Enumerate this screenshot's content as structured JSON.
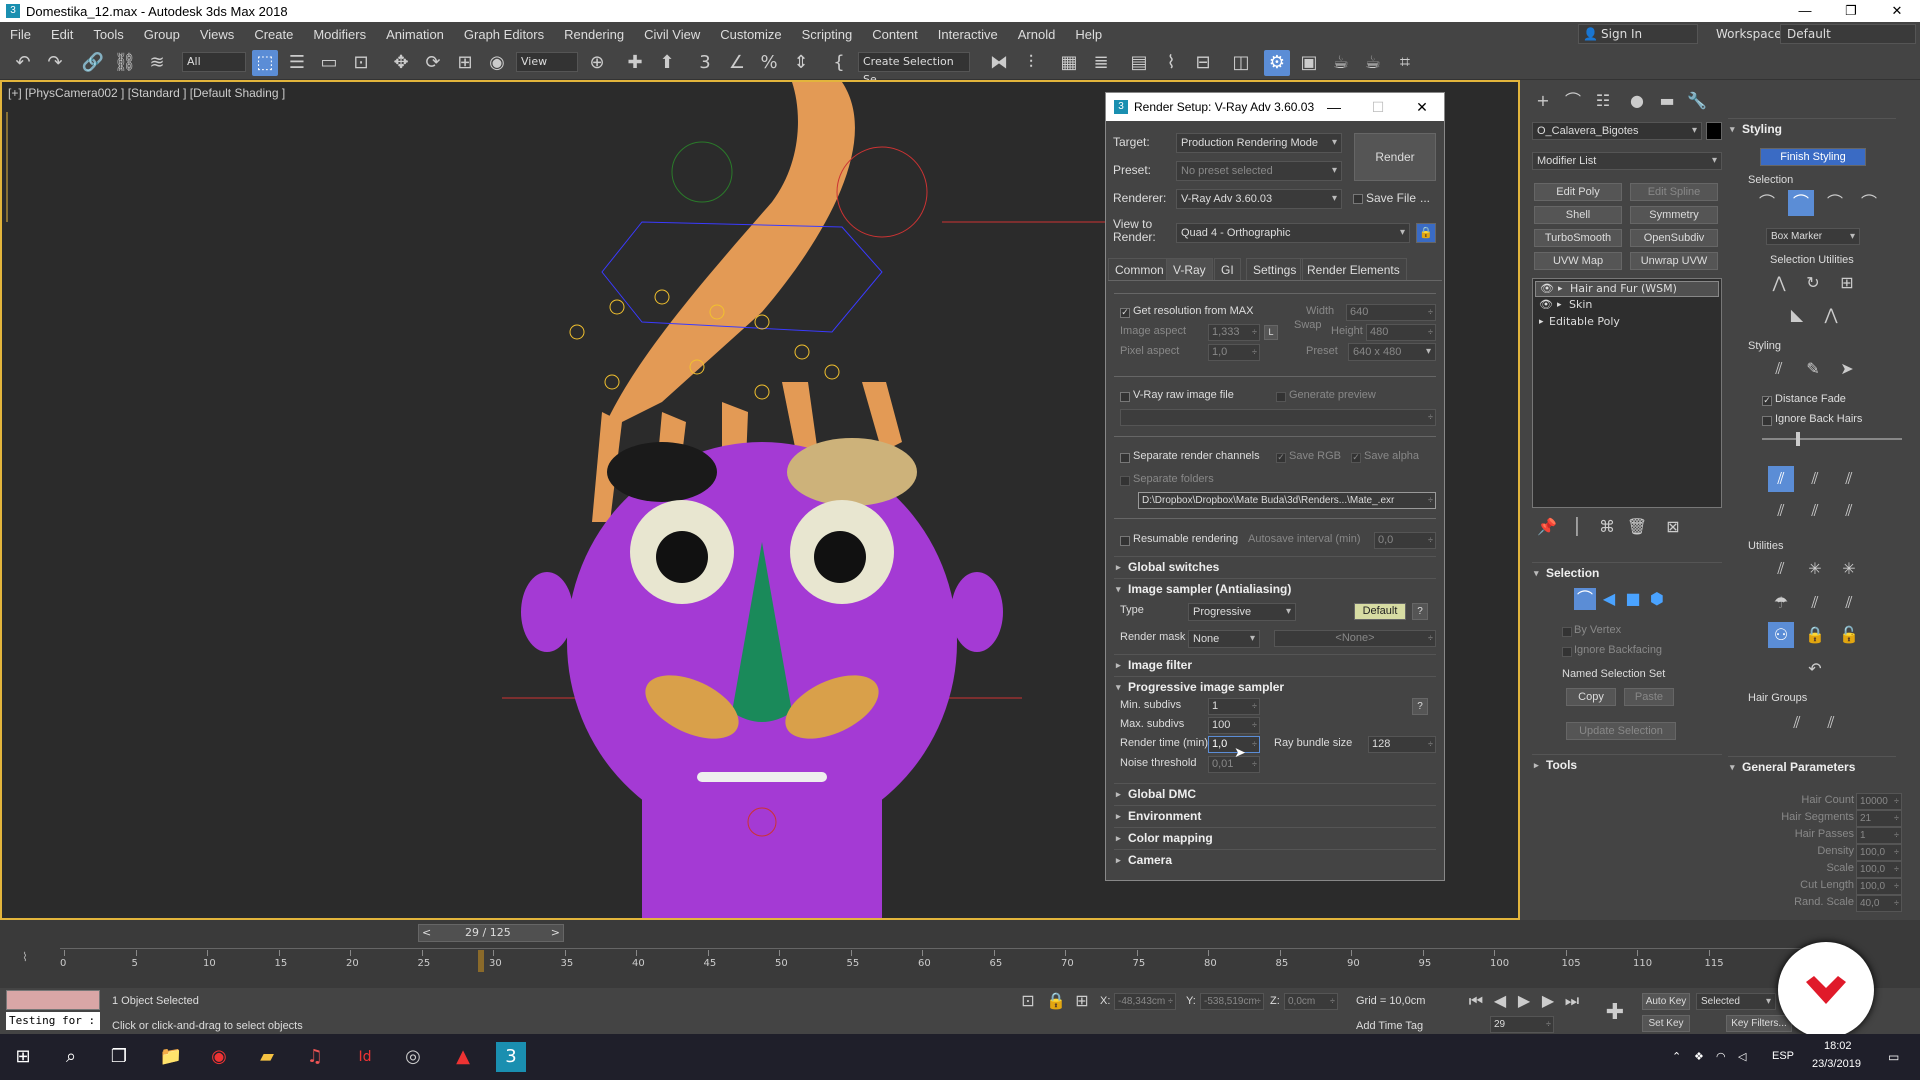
{
  "window": {
    "title": "Domestika_12.max - Autodesk 3ds Max 2018",
    "minimize": "—",
    "maximize": "❐",
    "close": "✕"
  },
  "menu": [
    "File",
    "Edit",
    "Tools",
    "Group",
    "Views",
    "Create",
    "Modifiers",
    "Animation",
    "Graph Editors",
    "Rendering",
    "Civil View",
    "Customize",
    "Scripting",
    "Content",
    "Interactive",
    "Arnold",
    "Help"
  ],
  "account": {
    "sign_in": "Sign In",
    "workspaces_label": "Workspaces:",
    "workspace": "Default"
  },
  "toolbar": {
    "filter": "All",
    "view": "View",
    "selection_set": "Create Selection Se"
  },
  "viewport": {
    "label": "[+] [PhysCamera002 ] [Standard ] [Default Shading ]"
  },
  "render_setup": {
    "title": "Render Setup: V-Ray Adv 3.60.03",
    "target_label": "Target:",
    "target": "Production Rendering Mode",
    "preset_label": "Preset:",
    "preset": "No preset selected",
    "renderer_label": "Renderer:",
    "renderer": "V-Ray Adv 3.60.03",
    "save_file": "Save File",
    "more": "...",
    "view_label": "View to Render:",
    "view": "Quad 4 - Orthographic",
    "render_button": "Render",
    "tabs": [
      "Common",
      "V-Ray",
      "GI",
      "Settings",
      "Render Elements"
    ],
    "get_res": "Get resolution from MAX",
    "width_label": "Width",
    "width": "640",
    "image_aspect_label": "Image aspect",
    "image_aspect": "1,333",
    "lock": "L",
    "swap": "Swap",
    "height_label": "Height",
    "height": "480",
    "pixel_aspect_label": "Pixel aspect",
    "pixel_aspect": "1,0",
    "preset_res_label": "Preset",
    "preset_res": "640 x 480",
    "raw_image": "V-Ray raw image file",
    "gen_preview": "Generate preview",
    "sep_channels": "Separate render channels",
    "save_rgb": "Save RGB",
    "save_alpha": "Save alpha",
    "sep_folders": "Separate folders",
    "path": "D:\\Dropbox\\Dropbox\\Mate Buda\\3d\\Renders...\\Mate_.exr",
    "resumable": "Resumable rendering",
    "autosave_label": "Autosave interval (min)",
    "autosave": "0,0",
    "global_switches": "Global switches",
    "image_sampler": "Image sampler (Antialiasing)",
    "type_label": "Type",
    "type": "Progressive",
    "default_btn": "Default",
    "help": "?",
    "render_mask_label": "Render mask",
    "render_mask": "None",
    "mask_none": "<None>",
    "image_filter": "Image filter",
    "prog_sampler": "Progressive image sampler",
    "min_subdivs_label": "Min. subdivs",
    "min_subdivs": "1",
    "max_subdivs_label": "Max. subdivs",
    "max_subdivs": "100",
    "render_time_label": "Render time (min)",
    "render_time": "1,0",
    "ray_bundle_label": "Ray bundle size",
    "ray_bundle": "128",
    "noise_label": "Noise threshold",
    "noise": "0,01",
    "global_dmc": "Global DMC",
    "environment": "Environment",
    "color_mapping": "Color mapping",
    "camera": "Camera"
  },
  "command_panel": {
    "object_name": "O_Calavera_Bigotes",
    "modifier_list": "Modifier List",
    "mod_buttons": [
      "Edit Poly",
      "Edit Spline",
      "Shell",
      "Symmetry",
      "TurboSmooth",
      "OpenSubdiv",
      "UVW Map",
      "Unwrap UVW"
    ],
    "stack": [
      "Hair and Fur (WSM)",
      "Skin",
      "Editable Poly"
    ],
    "selection": "Selection",
    "by_vertex": "By Vertex",
    "ignore_backfacing": "Ignore Backfacing",
    "named_sel": "Named Selection Set",
    "copy": "Copy",
    "paste": "Paste",
    "update_sel": "Update Selection",
    "tools": "Tools"
  },
  "hair_panel": {
    "styling": "Styling",
    "finish_styling": "Finish Styling",
    "selection": "Selection",
    "box_marker": "Box Marker",
    "sel_utils": "Selection Utilities",
    "styling2": "Styling",
    "distance_fade": "Distance Fade",
    "ignore_back": "Ignore Back Hairs",
    "utilities": "Utilities",
    "hair_groups": "Hair Groups",
    "general_params": "General Parameters",
    "params": [
      {
        "label": "Hair Count",
        "value": "10000"
      },
      {
        "label": "Hair Segments",
        "value": "21"
      },
      {
        "label": "Hair Passes",
        "value": "1"
      },
      {
        "label": "Density",
        "value": "100,0"
      },
      {
        "label": "Scale",
        "value": "100,0"
      },
      {
        "label": "Cut Length",
        "value": "100,0"
      },
      {
        "label": "Rand. Scale",
        "value": "40,0"
      }
    ]
  },
  "timeline": {
    "frame": "29 / 125",
    "prev": "<",
    "next": ">",
    "ticks": [
      "0",
      "5",
      "10",
      "15",
      "20",
      "25",
      "30",
      "35",
      "40",
      "45",
      "50",
      "55",
      "60",
      "65",
      "70",
      "75",
      "80",
      "85",
      "90",
      "95",
      "100",
      "105",
      "110",
      "115"
    ]
  },
  "status": {
    "maxscript": "Testing for :",
    "selected": "1 Object Selected",
    "prompt": "Click or click-and-drag to select objects",
    "x_label": "X:",
    "x": "-48,343cm",
    "y_label": "Y:",
    "y": "-538,519cm",
    "z_label": "Z:",
    "z": "0,0cm",
    "grid": "Grid = 10,0cm",
    "add_time_tag": "Add Time Tag",
    "auto_key": "Auto Key",
    "selected_mode": "Selected",
    "set_key": "Set Key",
    "key_filters": "Key Filters...",
    "frame": "29"
  },
  "taskbar": {
    "lang": "ESP",
    "time": "18:02",
    "date": "23/3/2019"
  }
}
